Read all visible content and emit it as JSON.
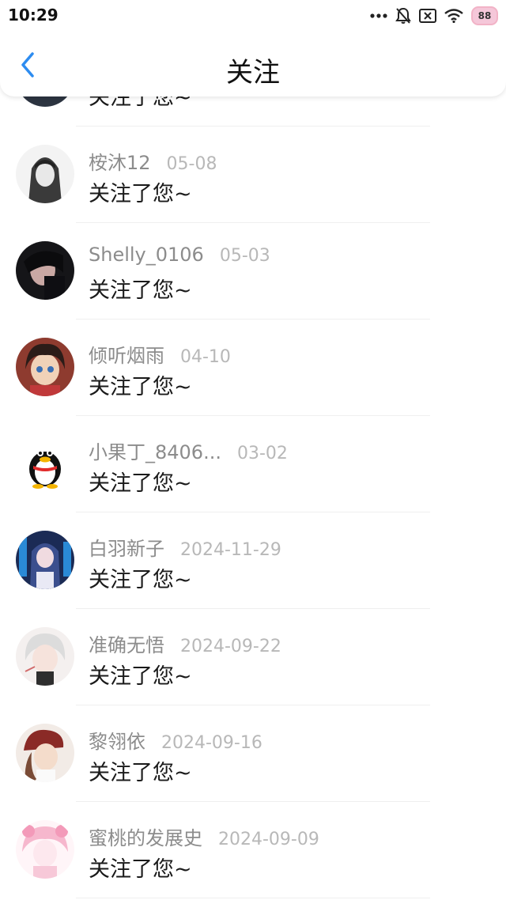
{
  "status_bar": {
    "time": "10:29",
    "battery": "88"
  },
  "header": {
    "title": "关注"
  },
  "items": [
    {
      "name": "",
      "date": "",
      "message": "关注了您~"
    },
    {
      "name": "桉沐12",
      "date": "05-08",
      "message": "关注了您~"
    },
    {
      "name": "Shelly_0106",
      "date": "05-03",
      "message": "关注了您~"
    },
    {
      "name": "倾听烟雨",
      "date": "04-10",
      "message": "关注了您~"
    },
    {
      "name": "小果丁_8406...",
      "date": "03-02",
      "message": "关注了您~"
    },
    {
      "name": "白羽新子",
      "date": "2024-11-29",
      "message": "关注了您~"
    },
    {
      "name": "准确无悟",
      "date": "2024-09-22",
      "message": "关注了您~"
    },
    {
      "name": "黎翎依",
      "date": "2024-09-16",
      "message": "关注了您~"
    },
    {
      "name": "蜜桃的发展史",
      "date": "2024-09-09",
      "message": "关注了您~"
    }
  ],
  "colors": {
    "accent": "#2d8cf0",
    "name": "#8c8c8c",
    "date": "#b8b8b8"
  }
}
